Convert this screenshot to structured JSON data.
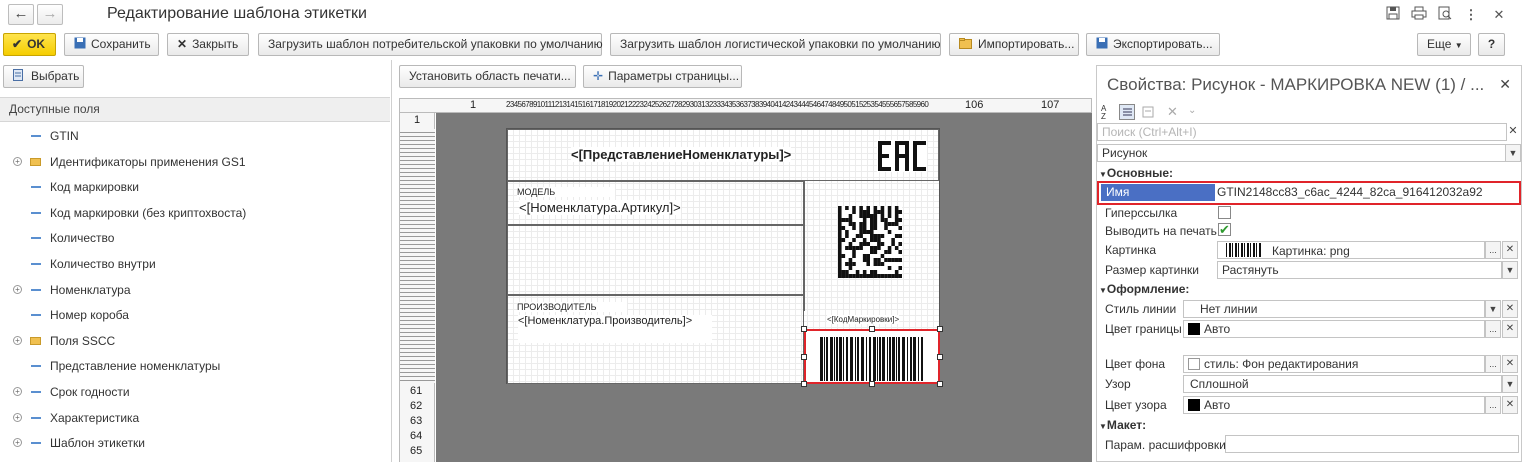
{
  "window": {
    "title": "Редактирование шаблона этикетки",
    "back_icon": "←",
    "forward_icon": "→"
  },
  "toolbar": {
    "ok": "OK",
    "save": "Сохранить",
    "close": "Закрыть",
    "load_consumer": "Загрузить шаблон потребительской упаковки по умолчанию",
    "load_logistic": "Загрузить шаблон логистической упаковки по умолчанию",
    "import": "Импортировать...",
    "export": "Экспортировать...",
    "more": "Еще",
    "help": "?"
  },
  "left_panel": {
    "select_button": "Выбрать",
    "header": "Доступные поля",
    "items": [
      {
        "label": "GTIN",
        "expandable": false,
        "folder": false
      },
      {
        "label": "Идентификаторы применения GS1",
        "expandable": true,
        "folder": true
      },
      {
        "label": "Код маркировки",
        "expandable": false,
        "folder": false
      },
      {
        "label": "Код маркировки (без криптохвоста)",
        "expandable": false,
        "folder": false
      },
      {
        "label": "Количество",
        "expandable": false,
        "folder": false
      },
      {
        "label": "Количество внутри",
        "expandable": false,
        "folder": false
      },
      {
        "label": "Номенклатура",
        "expandable": true,
        "folder": false
      },
      {
        "label": "Номер короба",
        "expandable": false,
        "folder": false
      },
      {
        "label": "Поля SSCC",
        "expandable": true,
        "folder": true
      },
      {
        "label": "Представление номенклатуры",
        "expandable": false,
        "folder": false
      },
      {
        "label": "Срок годности",
        "expandable": true,
        "folder": false
      },
      {
        "label": "Характеристика",
        "expandable": true,
        "folder": false
      },
      {
        "label": "Шаблон этикетки",
        "expandable": true,
        "folder": false
      }
    ]
  },
  "center": {
    "set_print_area": "Установить область печати...",
    "page_params": "Параметры страницы...",
    "ruler_top": {
      "left": "1",
      "dense": "23456789101112131415161718192021222324252627282930313233343536373839404142434445464748495051525354555657585960",
      "n106": "106",
      "n107": "107"
    },
    "ruler_left_rows": [
      "1",
      "61",
      "62",
      "63",
      "64",
      "65"
    ],
    "label": {
      "product": "<[ПредставлениеНоменклатуры]>",
      "eac": "EAC",
      "model_caption": "МОДЕЛЬ",
      "model_value": "<[Номенклатура.Артикул]>",
      "manufacturer_caption": "ПРОИЗВОДИТЕЛЬ",
      "manufacturer_value": "<[Номенклатура.Производитель]>",
      "marking_code": "<[КодМаркировки]>"
    }
  },
  "properties": {
    "title": "Свойства: Рисунок - МАРКИРОВКА NEW (1) / ...",
    "close_icon": "✕",
    "search_placeholder": "Поиск (Ctrl+Alt+I)",
    "object_type": "Рисунок",
    "section_basic": "Основные:",
    "name_label": "Имя",
    "name_value": "GTIN2148cc83_c6ac_4244_82ca_916412032a92",
    "hyperlink_label": "Гиперссылка",
    "hyperlink_checked": false,
    "print_label": "Выводить на печать",
    "print_checked": true,
    "picture_label": "Картинка",
    "picture_value": "Картинка: png",
    "picture_size_label": "Размер картинки",
    "picture_size_value": "Растянуть",
    "section_design": "Оформление:",
    "line_style_label": "Стиль линии",
    "line_style_value": "Нет линии",
    "border_color_label": "Цвет границы",
    "border_color_value": "Авто",
    "bg_color_label": "Цвет фона",
    "bg_color_value": "стиль: Фон редактирования",
    "pattern_label": "Узор",
    "pattern_value": "Сплошной",
    "pattern_color_label": "Цвет узора",
    "pattern_color_value": "Авто",
    "section_layout": "Макет:",
    "decode_param_label": "Парам. расшифровки",
    "decode_param_value": ""
  },
  "colors": {
    "ok_yellow": "#f5cd00",
    "selection_blue": "#4a6fc4",
    "highlight_red": "#e0242a",
    "check_green": "#2e9a2e"
  }
}
